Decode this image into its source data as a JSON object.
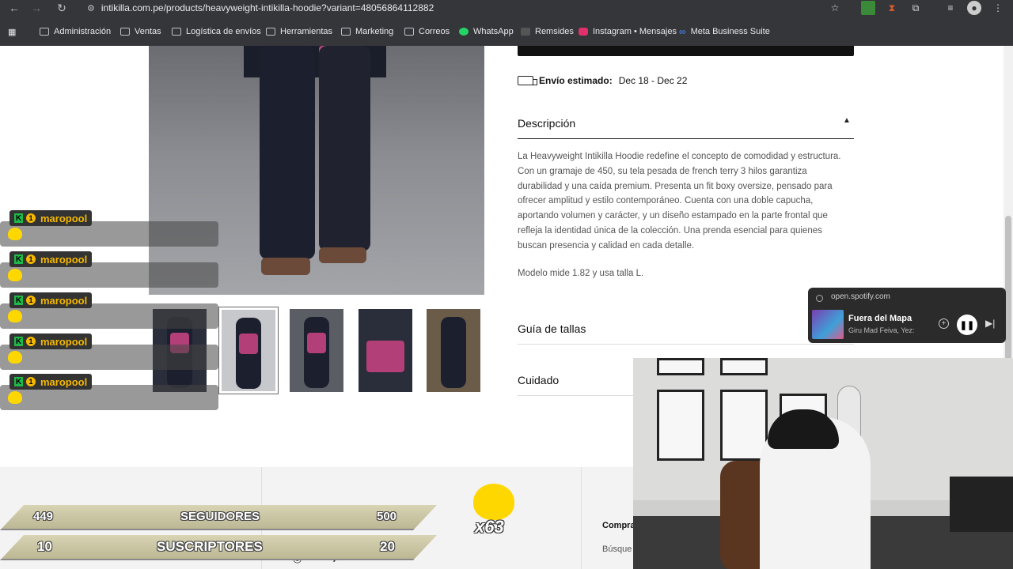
{
  "browser": {
    "url": "intikilla.com.pe/products/heavyweight-intikilla-hoodie?variant=48056864112882",
    "bookmarks": [
      {
        "label": "Administración",
        "icon": "folder-icon"
      },
      {
        "label": "Ventas",
        "icon": "folder-icon"
      },
      {
        "label": "Logística de envíos",
        "icon": "folder-icon"
      },
      {
        "label": "Herramientas",
        "icon": "folder-icon"
      },
      {
        "label": "Marketing",
        "icon": "folder-icon"
      },
      {
        "label": "Correos",
        "icon": "folder-icon"
      },
      {
        "label": "WhatsApp",
        "icon": "whatsapp-icon"
      },
      {
        "label": "Remsides",
        "icon": "remsides-icon"
      },
      {
        "label": "Instagram • Mensajes",
        "icon": "instagram-icon"
      },
      {
        "label": "Meta Business Suite",
        "icon": "meta-icon"
      }
    ]
  },
  "product": {
    "shipping_label": "Envío estimado:",
    "shipping_dates": "Dec 18 - Dec 22",
    "description_title": "Descripción",
    "description_text": "La Heavyweight Intikilla Hoodie redefine el concepto de comodidad y estructura. Con un gramaje de 450, su tela pesada de french terry 3 hilos garantiza durabilidad y una caída premium. Presenta un fit boxy oversize, pensado para ofrecer amplitud y estilo contemporáneo. Cuenta con una doble capucha, aportando volumen y carácter, y un diseño estampado en la parte frontal que refleja la identidad única de la colección. Una prenda esencial para quienes buscan presencia y calidad en cada detalle.",
    "model_text": "Modelo mide 1.82 y usa talla L.",
    "size_guide_title": "Guía de tallas",
    "care_title": "Cuidado"
  },
  "footer": {
    "col_head": "Compra",
    "col_link": "Búsque"
  },
  "stream": {
    "chat": [
      {
        "user": "maropool"
      },
      {
        "user": "maropool"
      },
      {
        "user": "maropool"
      },
      {
        "user": "maropool"
      },
      {
        "user": "maropool"
      }
    ],
    "followers": {
      "current": "449",
      "label": "SEGUIDORES",
      "goal": "500"
    },
    "subscribers": {
      "current": "10",
      "label": "SUSCRIPTORES",
      "goal": "20"
    },
    "emote_multiplier": "x63"
  },
  "spotify": {
    "host": "open.spotify.com",
    "track": "Fuera del Mapa",
    "artist": "Giru Mad Feiva, Yez:"
  }
}
